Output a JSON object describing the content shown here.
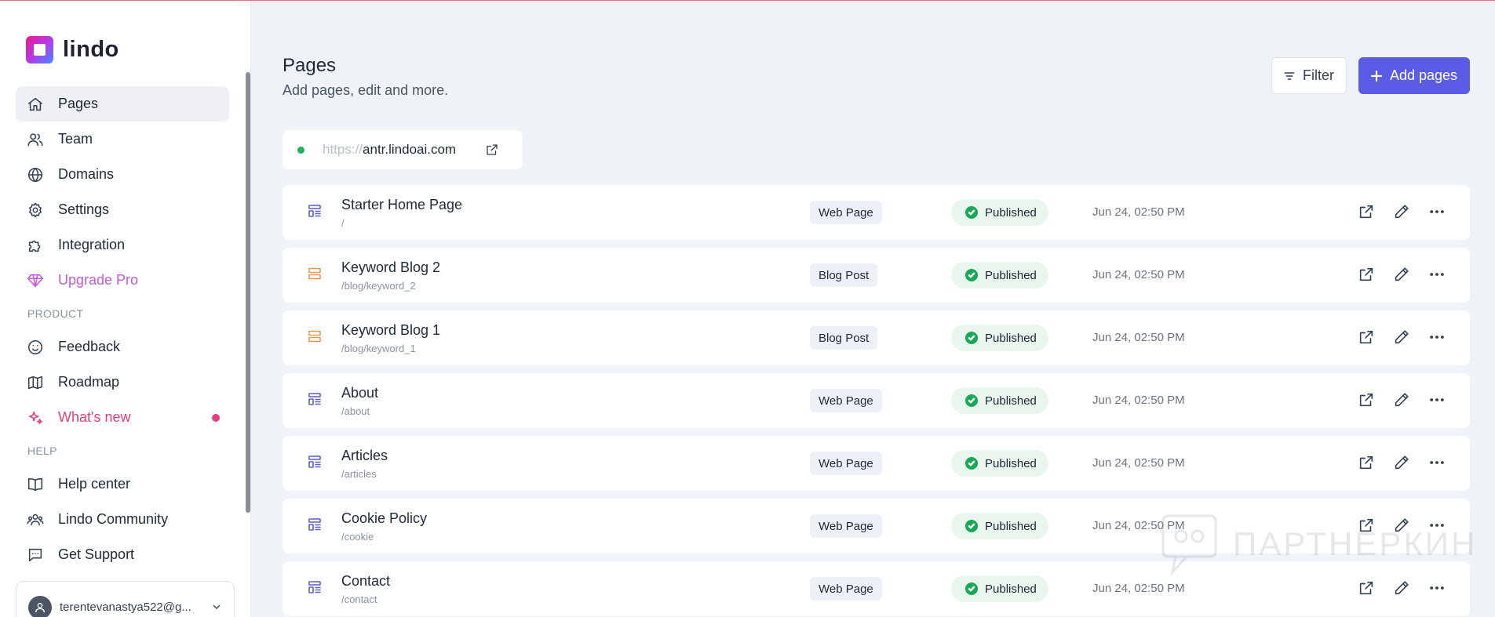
{
  "app": {
    "name": "lindo"
  },
  "sidebar": {
    "items": [
      {
        "label": "Pages",
        "icon": "home-icon",
        "active": true
      },
      {
        "label": "Team",
        "icon": "users-icon"
      },
      {
        "label": "Domains",
        "icon": "globe-icon"
      },
      {
        "label": "Settings",
        "icon": "gear-icon"
      },
      {
        "label": "Integration",
        "icon": "puzzle-icon"
      },
      {
        "label": "Upgrade Pro",
        "icon": "diamond-icon"
      }
    ],
    "product_section": "PRODUCT",
    "product_items": [
      {
        "label": "Feedback",
        "icon": "smile-icon"
      },
      {
        "label": "Roadmap",
        "icon": "map-icon"
      },
      {
        "label": "What's new",
        "icon": "sparkles-icon"
      }
    ],
    "help_section": "HELP",
    "help_items": [
      {
        "label": "Help center",
        "icon": "book-icon"
      },
      {
        "label": "Lindo Community",
        "icon": "community-icon"
      },
      {
        "label": "Get Support",
        "icon": "chat-icon"
      }
    ],
    "account": {
      "email": "terentevanastya522@g..."
    }
  },
  "header": {
    "title": "Pages",
    "subtitle": "Add pages, edit and more.",
    "filter_label": "Filter",
    "add_label": "Add pages"
  },
  "domain": {
    "protocol": "https://",
    "host": "antr.lindoai.com",
    "status_color": "#22b35e"
  },
  "pages": [
    {
      "name": "Starter Home Page",
      "path": "/",
      "type": "Web Page",
      "kind": "web",
      "status": "Published",
      "date": "Jun 24, 02:50 PM"
    },
    {
      "name": "Keyword Blog 2",
      "path": "/blog/keyword_2",
      "type": "Blog Post",
      "kind": "blog",
      "status": "Published",
      "date": "Jun 24, 02:50 PM"
    },
    {
      "name": "Keyword Blog 1",
      "path": "/blog/keyword_1",
      "type": "Blog Post",
      "kind": "blog",
      "status": "Published",
      "date": "Jun 24, 02:50 PM"
    },
    {
      "name": "About",
      "path": "/about",
      "type": "Web Page",
      "kind": "web",
      "status": "Published",
      "date": "Jun 24, 02:50 PM"
    },
    {
      "name": "Articles",
      "path": "/articles",
      "type": "Web Page",
      "kind": "web",
      "status": "Published",
      "date": "Jun 24, 02:50 PM"
    },
    {
      "name": "Cookie Policy",
      "path": "/cookie",
      "type": "Web Page",
      "kind": "web",
      "status": "Published",
      "date": "Jun 24, 02:50 PM"
    },
    {
      "name": "Contact",
      "path": "/contact",
      "type": "Web Page",
      "kind": "web",
      "status": "Published",
      "date": "Jun 24, 02:50 PM"
    }
  ],
  "watermark": {
    "text": "ПАРТНЕРКИН"
  },
  "colors": {
    "accent": "#5b5ce6",
    "upgrade": "#c15bd6",
    "whats_new": "#e4407f",
    "published": "#18a957"
  }
}
